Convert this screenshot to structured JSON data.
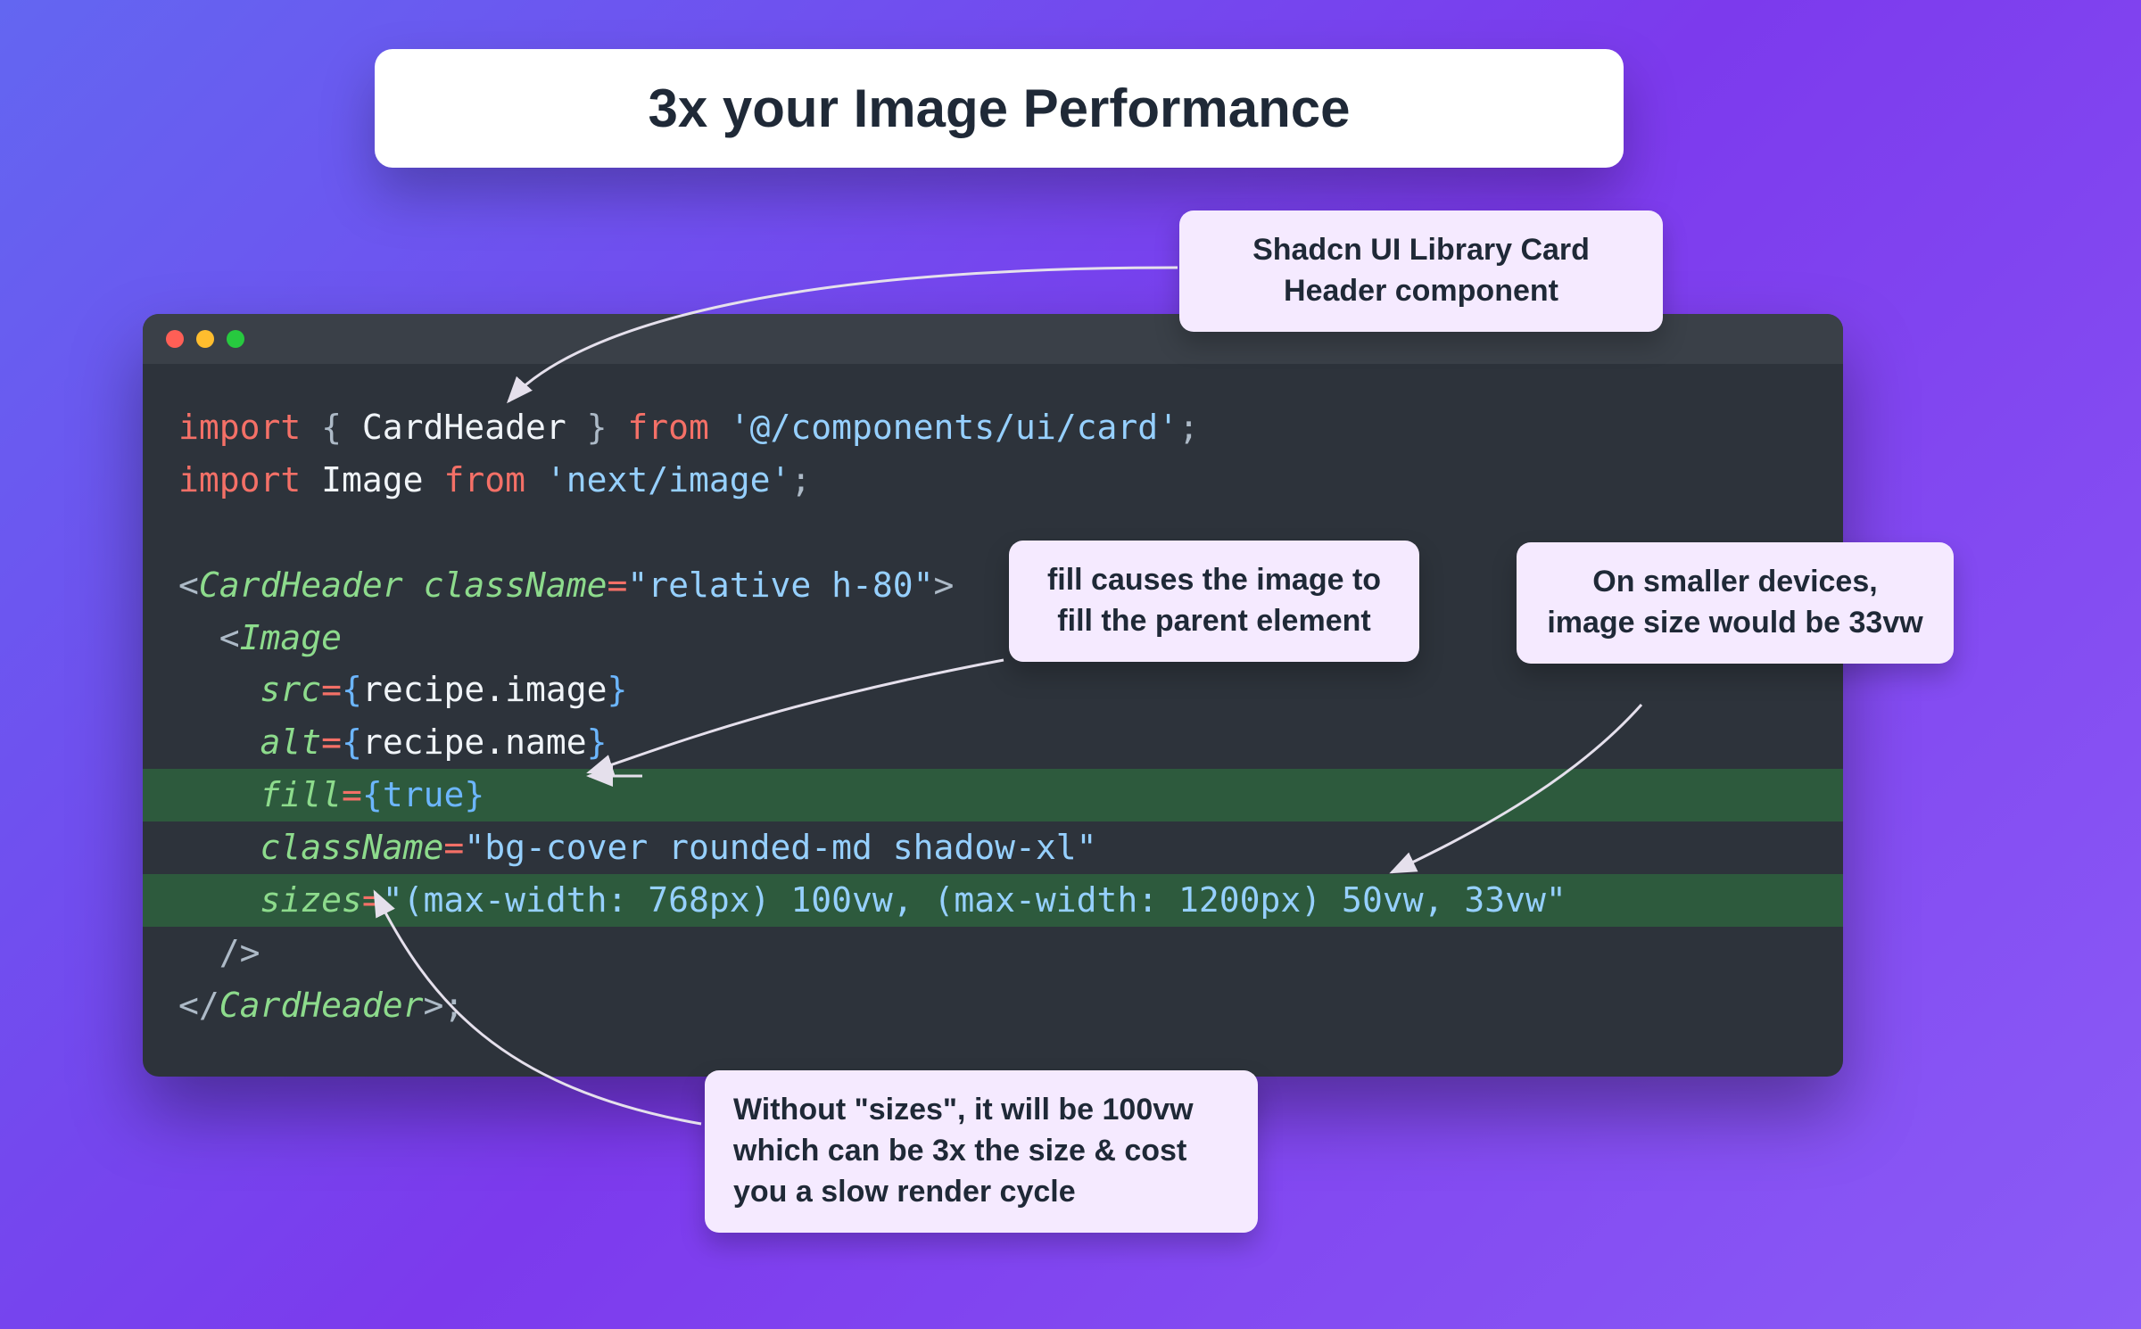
{
  "title": "3x your Image Performance",
  "callouts": {
    "shadcn": "Shadcn UI Library Card Header component",
    "fill": "fill causes the image to fill the parent element",
    "vw": "On smaller devices, image size would be 33vw",
    "sizes": "Without \"sizes\", it will be 100vw which can be 3x the size & cost you a slow render cycle"
  },
  "code": {
    "l1": {
      "a": "import",
      "b": " { ",
      "c": "CardHeader",
      "d": " } ",
      "e": "from",
      "f": " ",
      "g": "'@/components/ui/card'",
      "h": ";"
    },
    "l2": {
      "a": "import",
      "b": " ",
      "c": "Image",
      "d": " ",
      "e": "from",
      "f": " ",
      "g": "'next/image'",
      "h": ";"
    },
    "l3": "",
    "l4": {
      "a": "<",
      "b": "CardHeader",
      "c": " ",
      "d": "className",
      "e": "=",
      "f": "\"relative h-80\"",
      "g": ">"
    },
    "l5": {
      "a": "  <",
      "b": "Image"
    },
    "l6": {
      "a": "    ",
      "b": "src",
      "c": "=",
      "d": "{",
      "e": "recipe.image",
      "f": "}"
    },
    "l7": {
      "a": "    ",
      "b": "alt",
      "c": "=",
      "d": "{",
      "e": "recipe.name",
      "f": "}"
    },
    "l8": {
      "a": "    ",
      "b": "fill",
      "c": "=",
      "d": "{",
      "e": "true",
      "f": "}"
    },
    "l9": {
      "a": "    ",
      "b": "className",
      "c": "=",
      "d": "\"bg-cover rounded-md shadow-xl\""
    },
    "l10": {
      "a": "    ",
      "b": "sizes",
      "c": "=",
      "d": "\"(max-width: 768px) 100vw, (max-width: 1200px) 50vw, 33vw\""
    },
    "l11": {
      "a": "  />"
    },
    "l12": {
      "a": "</",
      "b": "CardHeader",
      "c": ">;"
    }
  }
}
